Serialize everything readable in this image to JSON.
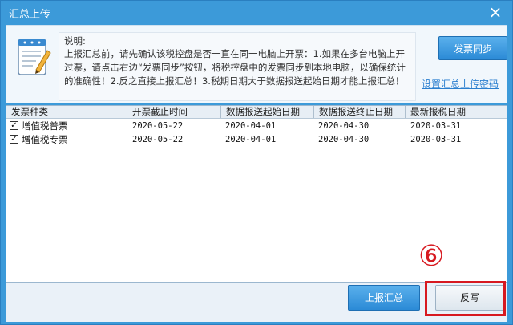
{
  "window": {
    "title": "汇总上传",
    "close_symbol": "×"
  },
  "info": {
    "label": "说明:",
    "text": "上报汇总前，请先确认该税控盘是否一直在同一电脑上开票：1.如果在多台电脑上开过票，请点击右边“发票同步”按钮，将税控盘中的发票同步到本地电脑，以确保统计的准确性！2.反之直接上报汇总！3.税期日期大于数据报送起始日期才能上报汇总！"
  },
  "actions": {
    "sync_label": "发票同步",
    "set_password_link": "设置汇总上传密码"
  },
  "table": {
    "columns": [
      "发票种类",
      "开票截止时间",
      "数据报送起始日期",
      "数据报送终止日期",
      "最新报税日期"
    ],
    "rows": [
      {
        "checked": true,
        "category": "增值税普票",
        "deadline": "2020-05-22",
        "start": "2020-04-01",
        "end": "2020-04-30",
        "latest": "2020-03-31"
      },
      {
        "checked": true,
        "category": "增值税专票",
        "deadline": "2020-05-22",
        "start": "2020-04-01",
        "end": "2020-04-30",
        "latest": "2020-03-31"
      }
    ]
  },
  "footer": {
    "upload_label": "上报汇总",
    "writeback_label": "反写",
    "annotation": "⑥"
  },
  "colors": {
    "window_blue": "#3c9ad9",
    "button_blue": "#2b8ad6",
    "highlight_red": "#d71920",
    "link_blue": "#2b7fcf"
  }
}
